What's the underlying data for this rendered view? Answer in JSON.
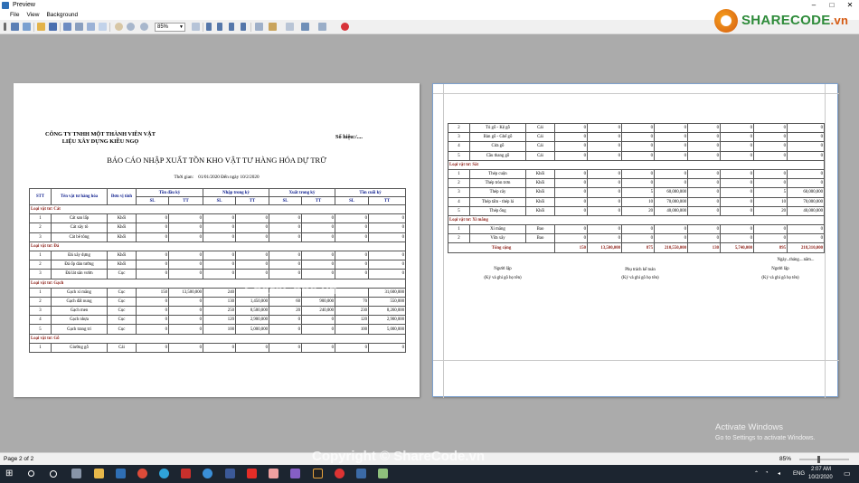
{
  "window": {
    "title": "Preview",
    "minimize": "–",
    "maximize": "□",
    "close": "✕"
  },
  "menu": {
    "file": "File",
    "view": "View",
    "background": "Background"
  },
  "toolbar": {
    "zoom_value": "85%"
  },
  "logo": {
    "brand": "SHARECODE",
    "suffix": ".vn"
  },
  "page1": {
    "company_line1": "CÔNG TY TNHH MỘT THÀNH VIÊN VẬT",
    "company_line2": "LIỆU XÂY DỰNG KIỀU NGỌ",
    "so_hieu": "Số hiệu:/....",
    "report_title": "BÁO CÁO NHẬP XUẤT TỒN KHO VẬT TƯ HÀNG HÓA DỰ TRỮ",
    "period_label": "Thời gian:",
    "period_value": "01/01/2020 Đến ngày 10/2/2020",
    "headers": {
      "stt": "STT",
      "name": "Tên vật tư hàng hóa",
      "unit": "Đơn vị tính",
      "opening": "Tồn đầu kỳ",
      "import": "Nhập trong kỳ",
      "export": "Xuất trong kỳ",
      "closing": "Tồn cuối kỳ",
      "sl": "SL",
      "tt": "TT"
    },
    "rows": [
      {
        "type": "group",
        "label": "Loại vật tư: Cát"
      },
      {
        "cells": [
          "1",
          "Cát san lấp",
          "Khối",
          "0",
          "0",
          "0",
          "0",
          "0",
          "0",
          "0",
          "0"
        ]
      },
      {
        "cells": [
          "2",
          "Cát xây tô",
          "Khối",
          "0",
          "0",
          "0",
          "0",
          "0",
          "0",
          "0",
          "0"
        ]
      },
      {
        "cells": [
          "3",
          "Cát bê tông",
          "Khối",
          "0",
          "0",
          "0",
          "0",
          "0",
          "0",
          "0",
          "0"
        ]
      },
      {
        "type": "group",
        "label": "Loại vật tư: Đá"
      },
      {
        "cells": [
          "1",
          "Đá xây dựng",
          "Khối",
          "0",
          "0",
          "0",
          "0",
          "0",
          "0",
          "0",
          "0"
        ]
      },
      {
        "cells": [
          "2",
          "Đá ốp dán tường",
          "Khối",
          "0",
          "0",
          "0",
          "0",
          "0",
          "0",
          "0",
          "0"
        ]
      },
      {
        "cells": [
          "3",
          "Đá lát sân vườn",
          "Cục",
          "0",
          "0",
          "0",
          "0",
          "0",
          "0",
          "0",
          "0"
        ]
      },
      {
        "type": "group",
        "label": "Loại vật tư: Gạch"
      },
      {
        "cells": [
          "1",
          "Gạch xi măng",
          "Cục",
          "150",
          "13,500,000",
          "240",
          "",
          "",
          "",
          "",
          "31,600,000"
        ]
      },
      {
        "cells": [
          "2",
          "Gạch đất nung",
          "Cục",
          "0",
          "0",
          "130",
          "1,450,000",
          "60",
          "900,000",
          "70",
          "550,000"
        ]
      },
      {
        "cells": [
          "3",
          "Gạch men",
          "Cục",
          "0",
          "0",
          "250",
          "8,500,000",
          "20",
          "240,000",
          "230",
          "8,260,000"
        ]
      },
      {
        "cells": [
          "4",
          "Gạch nhựa",
          "Cục",
          "0",
          "0",
          "120",
          "2,900,000",
          "0",
          "0",
          "120",
          "2,900,000"
        ]
      },
      {
        "cells": [
          "5",
          "Gạch trang trí",
          "Cục",
          "0",
          "0",
          "100",
          "5,000,000",
          "0",
          "0",
          "100",
          "5,000,000"
        ]
      },
      {
        "type": "group",
        "label": "Loại vật tư: Gỗ"
      },
      {
        "cells": [
          "1",
          "Giường gỗ",
          "Cái",
          "0",
          "0",
          "0",
          "0",
          "0",
          "0",
          "0",
          "0"
        ]
      }
    ]
  },
  "page2": {
    "rows": [
      {
        "cells": [
          "2",
          "Tủ gỗ - Kệ gỗ",
          "Cái",
          "0",
          "0",
          "0",
          "0",
          "0",
          "0",
          "0",
          "0"
        ]
      },
      {
        "cells": [
          "3",
          "Bàn gỗ - Ghế gỗ",
          "Cái",
          "0",
          "0",
          "0",
          "0",
          "0",
          "0",
          "0",
          "0"
        ]
      },
      {
        "cells": [
          "4",
          "Cửa gỗ",
          "Cái",
          "0",
          "0",
          "0",
          "0",
          "0",
          "0",
          "0",
          "0"
        ]
      },
      {
        "cells": [
          "5",
          "Cầu thang gỗ",
          "Cái",
          "0",
          "0",
          "0",
          "0",
          "0",
          "0",
          "0",
          "0"
        ]
      },
      {
        "type": "group",
        "label": "Loại vật tư: Sắt"
      },
      {
        "cells": [
          "1",
          "Thép cuộn",
          "Khối",
          "0",
          "0",
          "0",
          "0",
          "0",
          "0",
          "0",
          "0"
        ]
      },
      {
        "cells": [
          "2",
          "Thép tròn trơn",
          "Khối",
          "0",
          "0",
          "0",
          "0",
          "0",
          "0",
          "0",
          "0"
        ]
      },
      {
        "cells": [
          "3",
          "Thép cây",
          "Khối",
          "0",
          "0",
          "5",
          "60,000,000",
          "0",
          "0",
          "5",
          "60,000,000"
        ]
      },
      {
        "cells": [
          "4",
          "Thép tấm - thép lá",
          "Khối",
          "0",
          "0",
          "10",
          "70,000,000",
          "0",
          "0",
          "10",
          "70,000,000"
        ]
      },
      {
        "cells": [
          "5",
          "Thép ống",
          "Khối",
          "0",
          "0",
          "20",
          "40,000,000",
          "0",
          "0",
          "20",
          "40,000,000"
        ]
      },
      {
        "type": "group",
        "label": "Loại vật tư: Xi măng"
      },
      {
        "cells": [
          "1",
          "Xi măng",
          "Bao",
          "0",
          "0",
          "0",
          "0",
          "0",
          "0",
          "0",
          "0"
        ]
      },
      {
        "cells": [
          "2",
          "Vữa xây",
          "Bao",
          "0",
          "0",
          "0",
          "0",
          "0",
          "0",
          "0",
          "0"
        ]
      },
      {
        "type": "total",
        "label": "Tổng cộng",
        "values": [
          "150",
          "13,500,000",
          "875",
          "210,550,000",
          "130",
          "5,740,000",
          "895",
          "218,310,000"
        ]
      }
    ],
    "signature": {
      "date_line": "Ngày...tháng....năm...",
      "creator": "Người lập",
      "creator_note": "(Ký và ghi gõ họ tên)",
      "accountant": "Phụ trách kế toán",
      "accountant_note": "(Ký và ghi gõ họ tên)",
      "approver": "Người lập",
      "approver_note": "(Ký và ghi gõ họ tên)"
    }
  },
  "overlays": {
    "watermark": "ShareCode.vn",
    "copyright": "Copyright © ShareCode.vn",
    "activate_title": "Activate Windows",
    "activate_sub": "Go to Settings to activate Windows."
  },
  "status": {
    "page_info": "Page 2 of 2",
    "zoom": "85%"
  },
  "taskbar": {
    "lang": "ENG",
    "time": "2:07 AM",
    "date": "10/2/2020"
  }
}
